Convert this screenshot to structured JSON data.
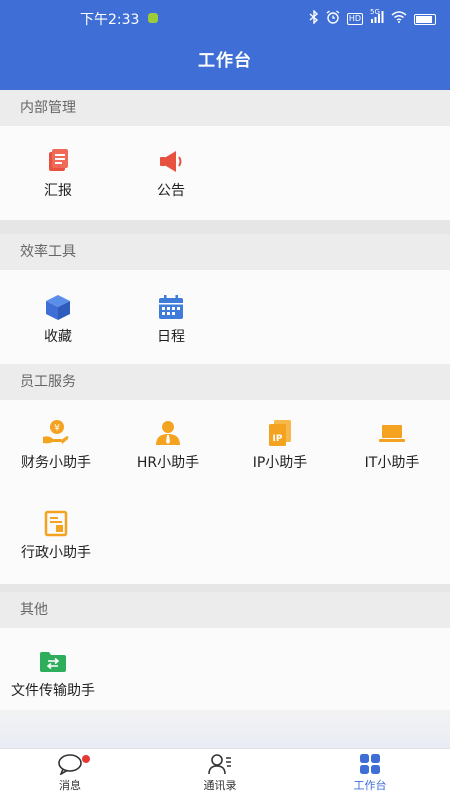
{
  "status_bar": {
    "time": "下午2:33",
    "hd": "HD",
    "net": "5G"
  },
  "header": {
    "title": "工作台"
  },
  "sections": [
    {
      "title": "内部管理",
      "items": [
        {
          "label": "汇报",
          "icon": "report-icon"
        },
        {
          "label": "公告",
          "icon": "announcement-icon"
        }
      ]
    },
    {
      "title": "效率工具",
      "items": [
        {
          "label": "收藏",
          "icon": "favorites-icon"
        },
        {
          "label": "日程",
          "icon": "calendar-icon"
        }
      ]
    },
    {
      "title": "员工服务",
      "items": [
        {
          "label": "财务小助手",
          "icon": "finance-icon"
        },
        {
          "label": "HR小助手",
          "icon": "hr-icon"
        },
        {
          "label": "IP小助手",
          "icon": "ip-icon"
        },
        {
          "label": "IT小助手",
          "icon": "laptop-icon"
        },
        {
          "label": "行政小助手",
          "icon": "admin-icon"
        }
      ]
    },
    {
      "title": "其他",
      "items": [
        {
          "label": "文件传输助手",
          "icon": "file-transfer-icon"
        }
      ]
    }
  ],
  "bottom_nav": [
    {
      "label": "消息",
      "icon": "message-icon",
      "active": false,
      "badge": true
    },
    {
      "label": "通讯录",
      "icon": "contacts-icon",
      "active": false
    },
    {
      "label": "工作台",
      "icon": "workbench-icon",
      "active": true
    }
  ],
  "colors": {
    "primary": "#3f6fd6",
    "red": "#e8513f",
    "orange": "#f4a321",
    "blue": "#3f7bd9",
    "green": "#2eae5a",
    "badge": "#e53935"
  }
}
